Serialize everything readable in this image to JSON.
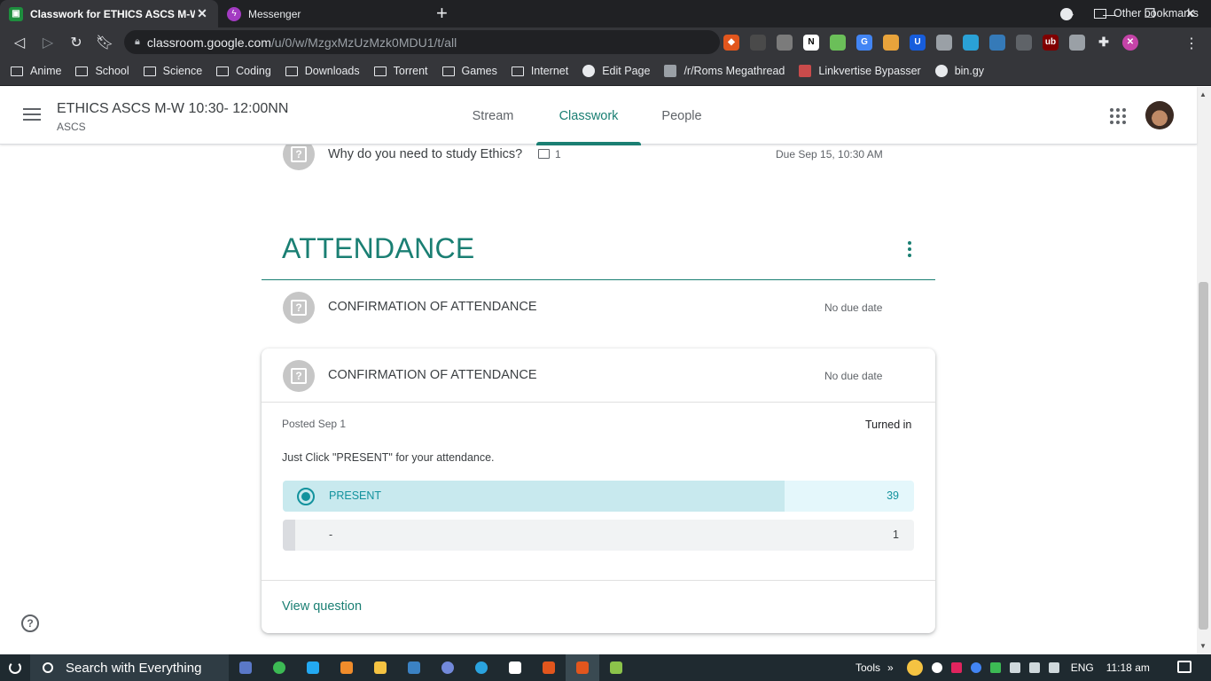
{
  "browser": {
    "tabs": [
      {
        "title": "Classwork for ETHICS ASCS M-W",
        "active": true,
        "favicon_color": "#1e8e3e"
      },
      {
        "title": "Messenger",
        "active": false,
        "favicon_color": "#a33bc2"
      }
    ],
    "url_host": "classroom.google.com",
    "url_path": "/u/0/w/MzgxMzUzMzk0MDU1/t/all",
    "bookmarks": [
      {
        "label": "Anime",
        "icon": "folder-icon"
      },
      {
        "label": "School",
        "icon": "folder-icon"
      },
      {
        "label": "Science",
        "icon": "folder-icon"
      },
      {
        "label": "Coding",
        "icon": "folder-icon"
      },
      {
        "label": "Downloads",
        "icon": "folder-icon"
      },
      {
        "label": "Torrent",
        "icon": "folder-icon"
      },
      {
        "label": "Games",
        "icon": "folder-icon"
      },
      {
        "label": "Internet",
        "icon": "folder-icon"
      },
      {
        "label": "Edit Page",
        "icon": "globe-icon"
      },
      {
        "label": "/r/Roms Megathread",
        "icon": "page-icon"
      },
      {
        "label": "Linkvertise Bypasser",
        "icon": "page-icon"
      },
      {
        "label": "bin.gy",
        "icon": "globe-icon"
      }
    ],
    "bookmarks_more": "»",
    "other_bookmarks": "Other bookmarks"
  },
  "classroom": {
    "class_name": "ETHICS ASCS M-W 10:30- 12:00NN",
    "section": "ASCS",
    "tabs": [
      "Stream",
      "Classwork",
      "People"
    ],
    "active_tab": "Classwork",
    "accent": "#1a7f73"
  },
  "items": {
    "ethics_question": {
      "title": "Why do you need to study Ethics?",
      "comments": "1",
      "due": "Due Sep 15, 10:30 AM"
    },
    "topic": {
      "title": "ATTENDANCE"
    },
    "attendance_1": {
      "title": "CONFIRMATION OF ATTENDANCE",
      "due": "No due date"
    },
    "attendance_card": {
      "title": "CONFIRMATION OF ATTENDANCE",
      "due": "No due date",
      "posted": "Posted Sep 1",
      "status": "Turned in",
      "instruction": "Just Click \"PRESENT\" for your attendance.",
      "options": [
        {
          "label": "PRESENT",
          "count": "39",
          "share": 0.795,
          "selected": true
        },
        {
          "label": "-",
          "count": "1",
          "share": 0.02,
          "selected": false
        }
      ],
      "view_link": "View question"
    }
  },
  "help_icon": "?",
  "taskbar": {
    "search_placeholder": "Search with Everything",
    "tools_label": "Tools",
    "tray_more": "»",
    "language": "ENG",
    "time": "11:18 am"
  }
}
